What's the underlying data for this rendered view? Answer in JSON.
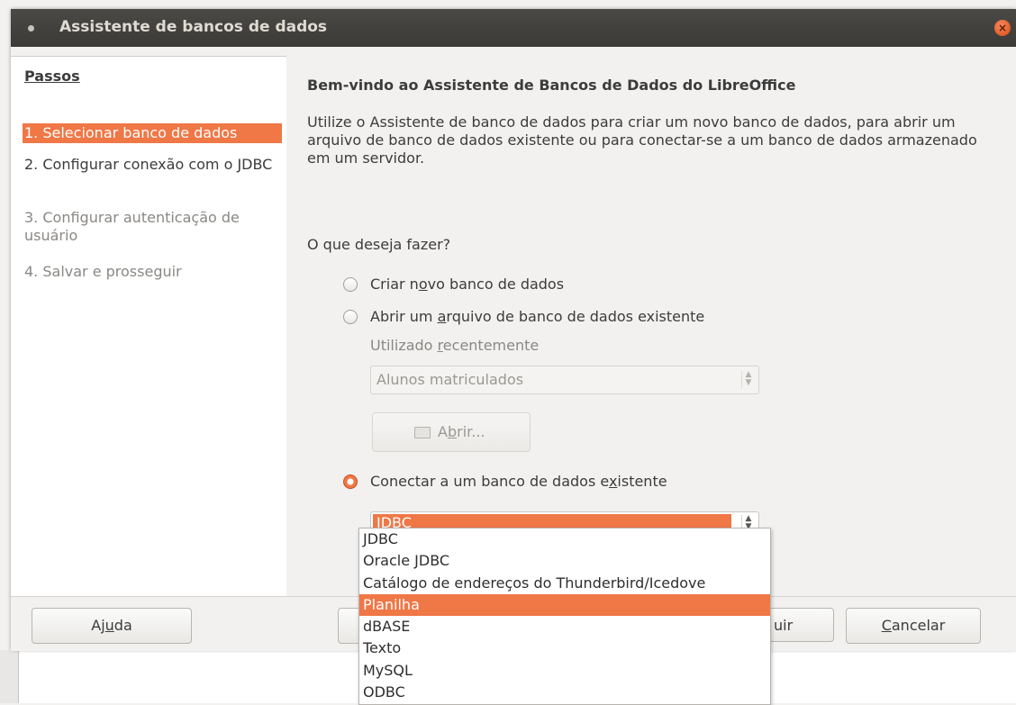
{
  "window": {
    "title": "Assistente de bancos de dados"
  },
  "steps": {
    "header": "Passos",
    "items": [
      {
        "label": "1. Selecionar banco de dados"
      },
      {
        "label": "2. Configurar conexão com o JDBC"
      },
      {
        "label": "3. Configurar autenticação de usuário"
      },
      {
        "label": "4. Salvar e prosseguir"
      }
    ]
  },
  "main": {
    "title": "Bem-vindo ao Assistente de Bancos de Dados do LibreOffice",
    "intro": "Utilize o Assistente de banco de dados para criar um novo banco de dados, para abrir um arquivo de banco de dados existente ou para conectar-se a um banco de dados armazenado em um servidor.",
    "question": "O que deseja fazer?",
    "option_new": {
      "pre": "Criar n",
      "ul": "o",
      "post": "vo banco de dados"
    },
    "option_open": {
      "pre": "Abrir um ",
      "ul": "a",
      "post": "rquivo de banco de dados existente"
    },
    "recent_label": {
      "pre": "Utilizado ",
      "ul": "r",
      "post": "ecentemente"
    },
    "recent_value": "Alunos matriculados",
    "open_button": {
      "pre": "A",
      "ul": "b",
      "post": "rir..."
    },
    "option_connect": {
      "pre": "Conectar a um banco de dados e",
      "ul": "x",
      "post": "istente"
    },
    "connect_value": "JDBC",
    "connect_options": [
      "JDBC",
      "Oracle JDBC",
      "Catálogo de endereços do Thunderbird/Icedove",
      "Planilha",
      "dBASE",
      "Texto",
      "MySQL",
      "ODBC"
    ]
  },
  "footer": {
    "help": {
      "pre": "Aj",
      "ul": "u",
      "post": "da"
    },
    "back_partial": "",
    "next_partial": "uir",
    "cancel": {
      "pre": "",
      "ul": "C",
      "post": "ancelar"
    }
  }
}
